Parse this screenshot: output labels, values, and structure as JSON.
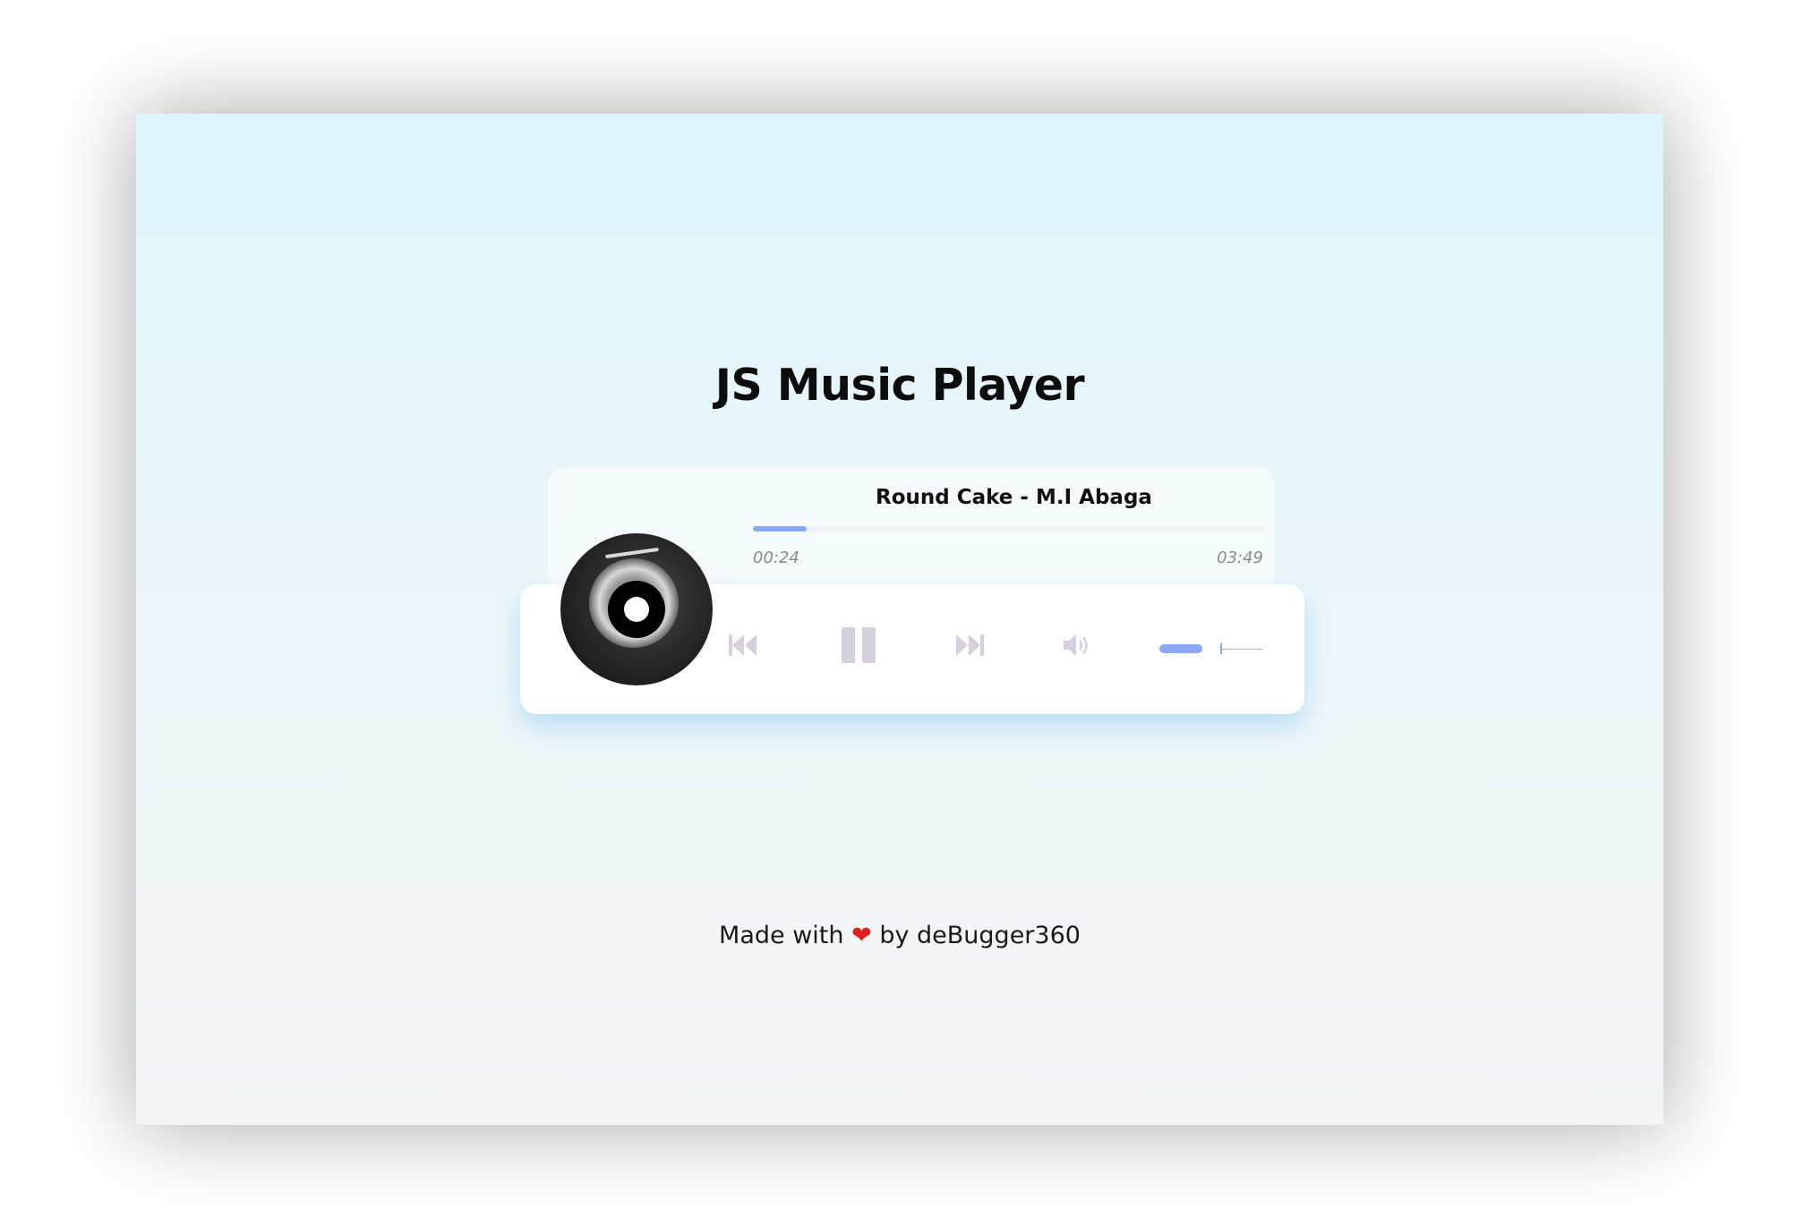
{
  "app": {
    "title": "JS Music Player"
  },
  "track": {
    "title": "Round Cake - M.I Abaga",
    "current_time": "00:24",
    "total_time": "03:49",
    "progress_fraction": 0.105
  },
  "controls": {
    "prev_icon": "skip-back-icon",
    "pause_icon": "pause-icon",
    "next_icon": "skip-forward-icon",
    "volume_icon": "volume-icon"
  },
  "volume": {
    "level_fraction": 0.6
  },
  "footer": {
    "prefix": "Made with",
    "heart": "❤",
    "suffix": "by deBugger360"
  },
  "colors": {
    "accent": "#8ca8f2",
    "control_icon": "#d6cfdc",
    "heart": "#e02020"
  }
}
